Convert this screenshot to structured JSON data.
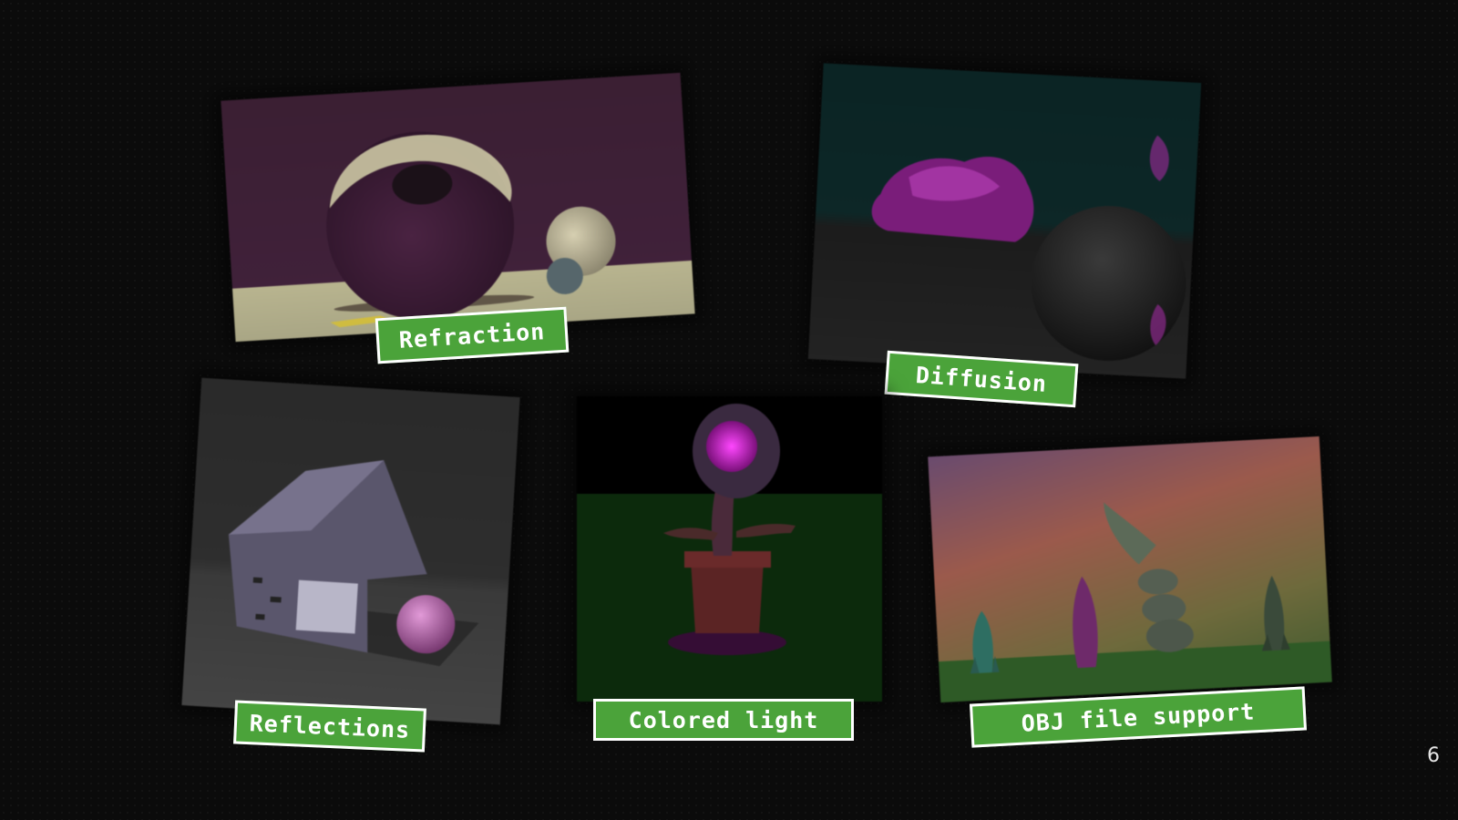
{
  "slide": {
    "page_number": "6",
    "accent_color": "#4ba33a",
    "background_color": "#0b0b0b"
  },
  "renders": [
    {
      "id": "refraction",
      "label": "Refraction"
    },
    {
      "id": "diffusion",
      "label": "Diffusion"
    },
    {
      "id": "reflections",
      "label": "Reflections"
    },
    {
      "id": "colored-light",
      "label": "Colored light"
    },
    {
      "id": "obj-support",
      "label": "OBJ file support"
    }
  ]
}
